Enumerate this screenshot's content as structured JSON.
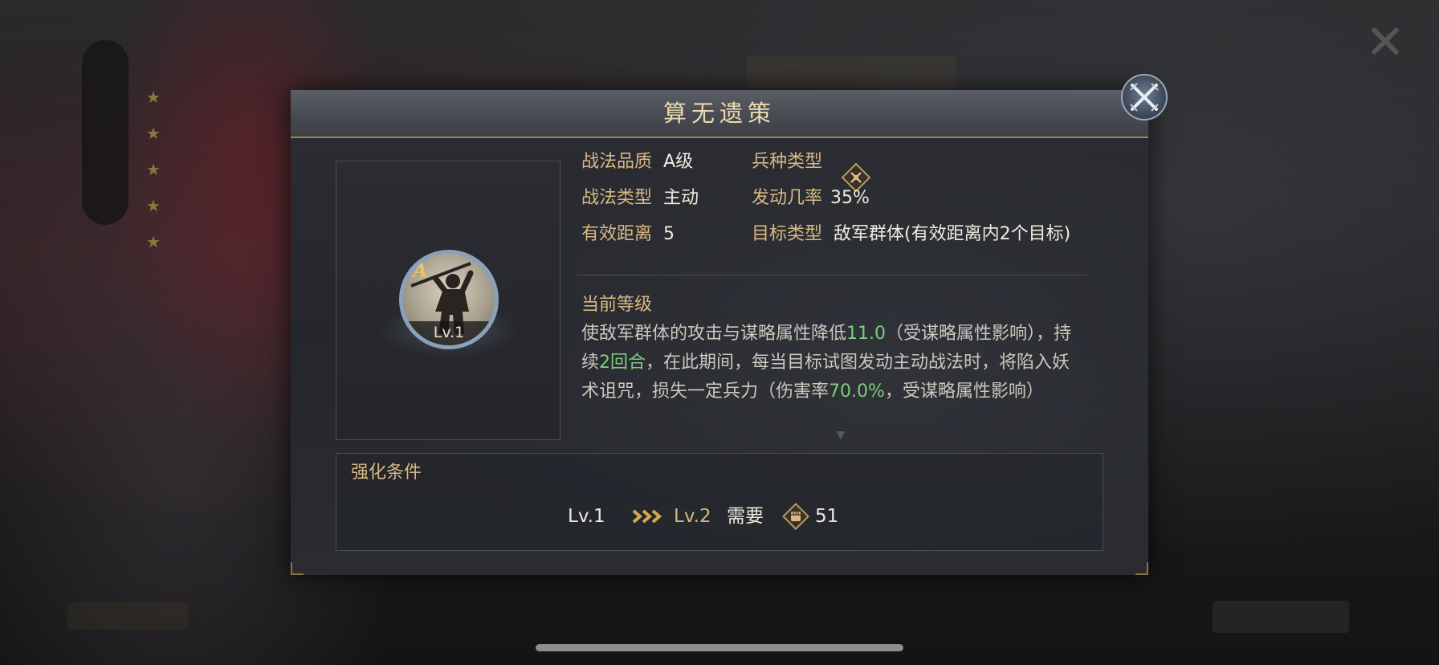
{
  "dialog": {
    "title": "算无遗策",
    "close_icon": "crossed-swords-close-icon"
  },
  "skill": {
    "grade_letter": "A",
    "level": "Lv.1",
    "icon": "spear-warrior-skill-icon"
  },
  "attributes": {
    "quality": {
      "label": "战法品质",
      "value": "A级"
    },
    "type": {
      "label": "战法类型",
      "value": "主动"
    },
    "range": {
      "label": "有效距离",
      "value": "5"
    },
    "troop_type": {
      "label": "兵种类型",
      "icon": "troop-type-icon"
    },
    "trigger_rate": {
      "label": "发动几率",
      "value": "35%"
    },
    "target_type": {
      "label": "目标类型",
      "value": "敌军群体(有效距离内2个目标)"
    }
  },
  "current_level": {
    "title": "当前等级",
    "desc_1": "使敌军群体的攻击与谋略属性降低",
    "desc_val_1": "11.0",
    "desc_2": "（受谋略属性影响）",
    "desc_3": "，持续",
    "desc_val_2": "2回合",
    "desc_4": "，在此期间，每当目标试图发动主动战法时，将陷入妖术诅咒，损失一定兵力（伤害率",
    "desc_val_3": "70.0%",
    "desc_5": "，受谋略属性影响）"
  },
  "upgrade": {
    "title": "强化条件",
    "from": "Lv.1",
    "to": "Lv.2",
    "need_label": "需要",
    "cost": "51",
    "arrow_icon": "triple-chevron-arrow-icon",
    "cost_icon": "fist-token-icon"
  },
  "colors": {
    "accent_gold": "#d9b884",
    "highlight_green": "#7ecb7e",
    "title_gold": "#ecd8ae"
  }
}
